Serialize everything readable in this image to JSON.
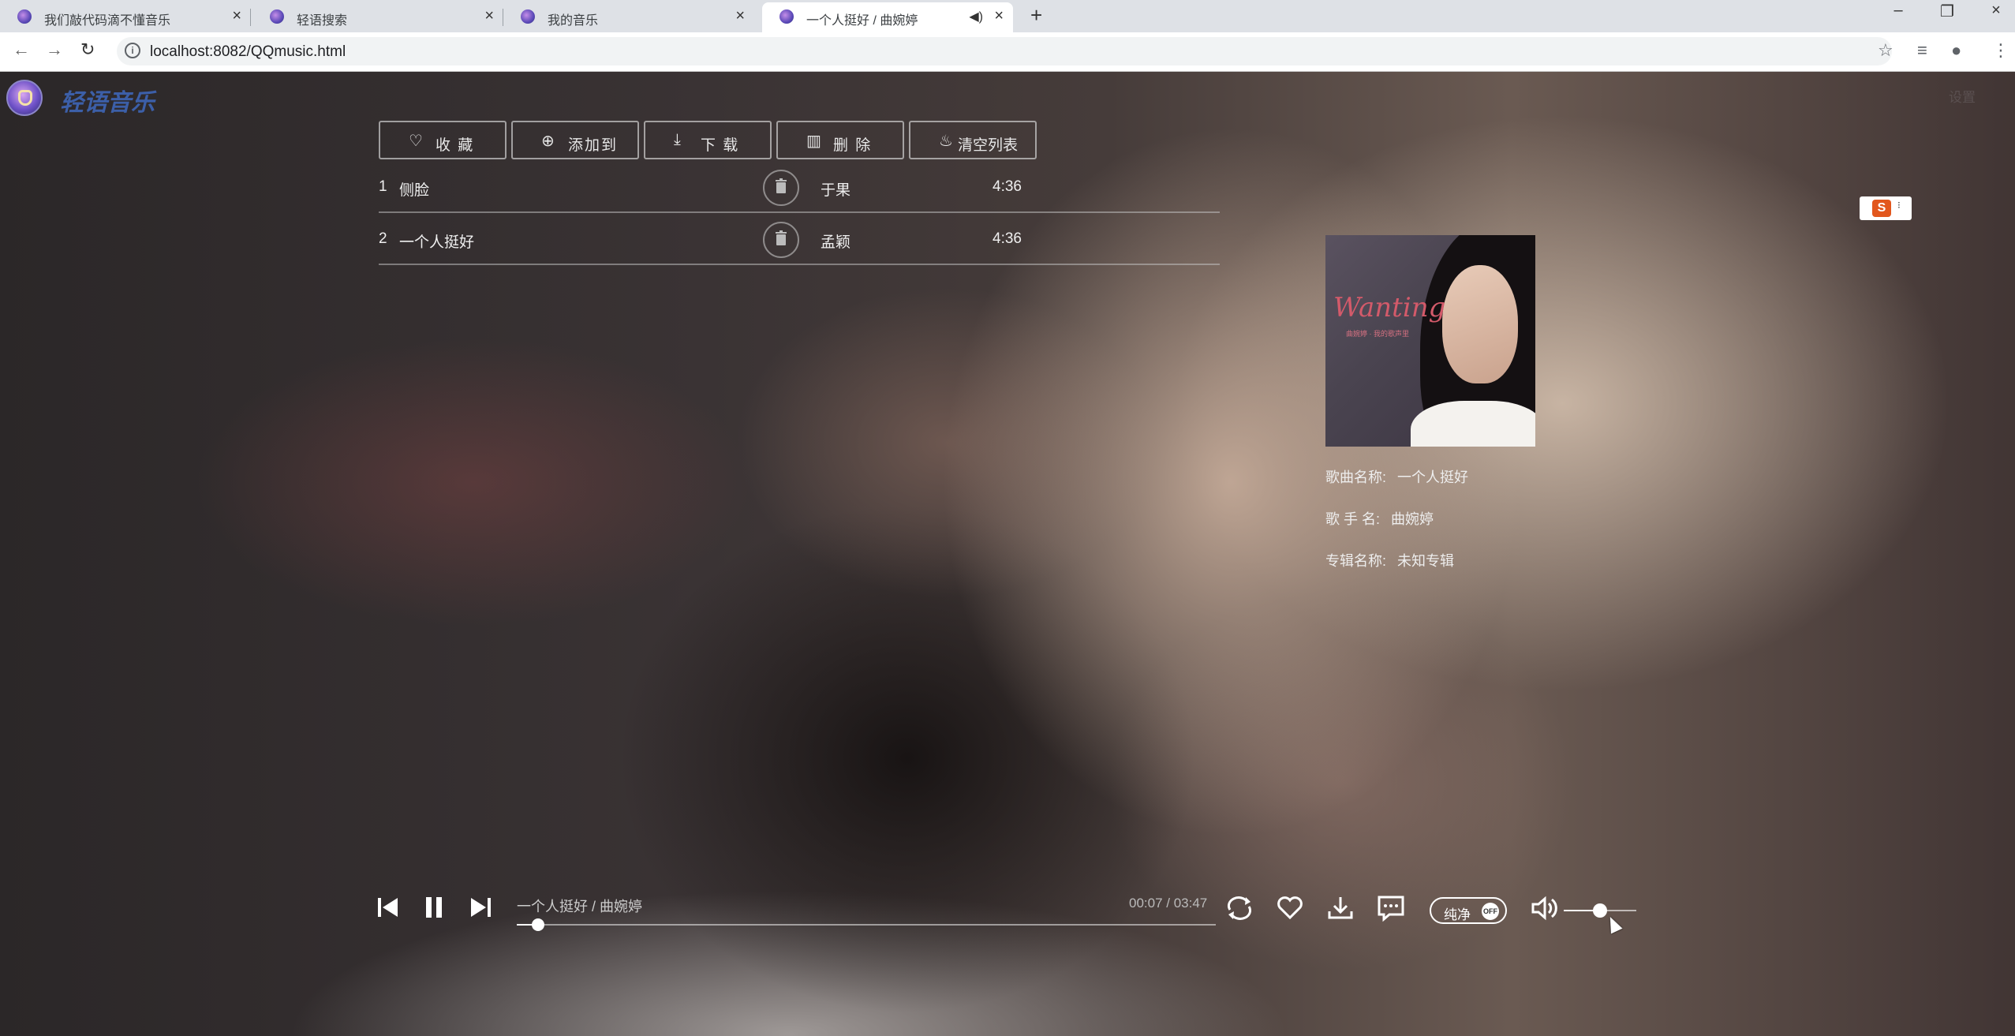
{
  "browser": {
    "tabs": [
      {
        "title": "我们敲代码滴不懂音乐"
      },
      {
        "title": "轻语搜索"
      },
      {
        "title": "我的音乐"
      },
      {
        "title": "一个人挺好 / 曲婉婷"
      }
    ],
    "close_glyph": "×",
    "new_tab_glyph": "+",
    "url": "localhost:8082/QQmusic.html"
  },
  "app": {
    "brand": "轻语音乐",
    "settings_label": "设置",
    "actions": [
      {
        "label": "收 藏",
        "icon": "heart-icon"
      },
      {
        "label": "添加到",
        "icon": "add-circle-icon"
      },
      {
        "label": "下 载",
        "icon": "download-icon"
      },
      {
        "label": "删 除",
        "icon": "trash-icon"
      },
      {
        "label": "清空列表",
        "icon": "fire-icon"
      }
    ],
    "playlist": [
      {
        "num": "1",
        "name": "侧脸",
        "artist": "于果",
        "duration": "4:36"
      },
      {
        "num": "2",
        "name": "一个人挺好",
        "artist": "孟颖",
        "duration": "4:36"
      }
    ],
    "ime_glyph": "S",
    "cover": {
      "script_text": "Wanting",
      "subtext": "曲婉婷 · 我的歌声里"
    },
    "info": {
      "song_label": "歌曲名称:",
      "song_value": "一个人挺好",
      "singer_label": "歌 手 名:",
      "singer_value": "曲婉婷",
      "album_label": "专辑名称:",
      "album_value": "未知专辑"
    }
  },
  "player": {
    "now_playing": "一个人挺好 / 曲婉婷",
    "time": "00:07 / 03:47",
    "progress_fraction": 0.031,
    "pure_label": "纯净",
    "pure_state": "OFF",
    "volume_fraction": 0.5,
    "icons": [
      "previous-icon",
      "pause-icon",
      "next-icon",
      "loop-icon",
      "favorite-icon",
      "download-icon",
      "comment-icon",
      "volume-icon"
    ]
  }
}
